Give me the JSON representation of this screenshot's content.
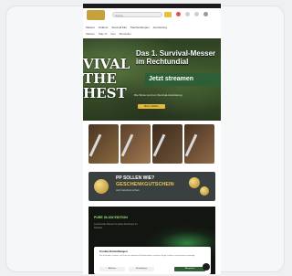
{
  "header": {
    "search_placeholder": "Suche..."
  },
  "nav": {
    "items": [
      "Messer",
      "Outdoor",
      "Survival Kits",
      "Taschenlampen",
      "Ausrüstung"
    ],
    "subitems": [
      "Marken",
      "Sale %",
      "Neu",
      "Bestseller"
    ]
  },
  "hero": {
    "show_text": "VIVAL\nTHE\nHEST",
    "title": "Das 1. Survival-Messer\nim Rechtundial",
    "cta_band": "Jetzt streamen",
    "subtitle": "Die Show rund um Survival-Ausrüstung",
    "button": "Mehr erfahren"
  },
  "tiles": [
    {
      "colors": [
        "#4a3520",
        "#8a6a40"
      ]
    },
    {
      "colors": [
        "#5a3f2a",
        "#a07850"
      ]
    },
    {
      "colors": [
        "#3d2c1c",
        "#6e5238"
      ]
    },
    {
      "colors": [
        "#4b3322",
        "#8d6a48"
      ]
    }
  ],
  "banner": {
    "line1": "PP SOLLEN WIE?",
    "line2": "GESCHENKGUTSCHEIN",
    "small": "Jetzt Gutschein sichern"
  },
  "dark_section": {
    "title": "PURE GLOW EDITION",
    "text": "Leuchtende Messer für jedes Abenteuer im Dunkeln."
  },
  "cookie": {
    "title": "Cookie-Einstellungen",
    "text": "Wir verwenden Cookies, um Ihnen ein optimales Einkaufserlebnis zu bieten. Einige Cookies sind technisch notwendig.",
    "decline": "Ablehnen",
    "settings": "Einstellungen",
    "accept": "Akzeptieren"
  },
  "colors": {
    "brand_gold": "#c7a23a",
    "accent_yellow": "#e2b93b",
    "hero_green": "#2d5e35"
  }
}
